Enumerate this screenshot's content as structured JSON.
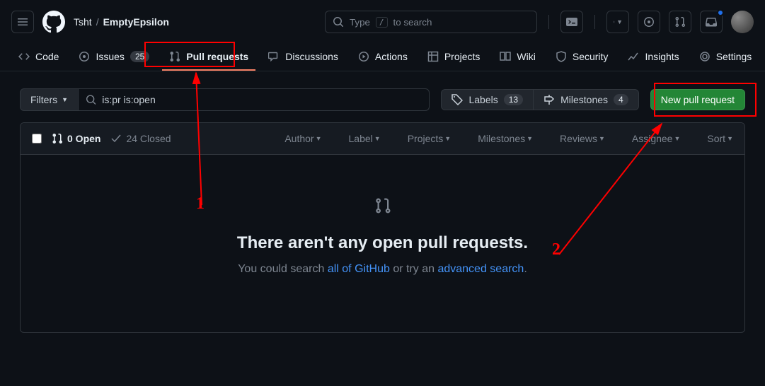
{
  "breadcrumb": {
    "owner": "Tsht",
    "repo": "EmptyEpsilon"
  },
  "search": {
    "prefix": "Type",
    "key": "/",
    "suffix": "to search"
  },
  "nav": {
    "code": "Code",
    "issues": "Issues",
    "issues_count": "25",
    "pulls": "Pull requests",
    "discussions": "Discussions",
    "actions": "Actions",
    "projects": "Projects",
    "wiki": "Wiki",
    "security": "Security",
    "insights": "Insights",
    "settings": "Settings"
  },
  "toolbar": {
    "filters": "Filters",
    "query": "is:pr is:open",
    "labels": "Labels",
    "labels_count": "13",
    "milestones": "Milestones",
    "milestones_count": "4",
    "new_pr": "New pull request"
  },
  "list_header": {
    "open": "0 Open",
    "closed": "24 Closed",
    "author": "Author",
    "label": "Label",
    "projects": "Projects",
    "milestones": "Milestones",
    "reviews": "Reviews",
    "assignee": "Assignee",
    "sort": "Sort"
  },
  "empty": {
    "title": "There aren't any open pull requests.",
    "text1": "You could search ",
    "link1": "all of GitHub",
    "text2": " or try an ",
    "link2": "advanced search",
    "text3": "."
  },
  "annotations": {
    "one": "1",
    "two": "2"
  }
}
